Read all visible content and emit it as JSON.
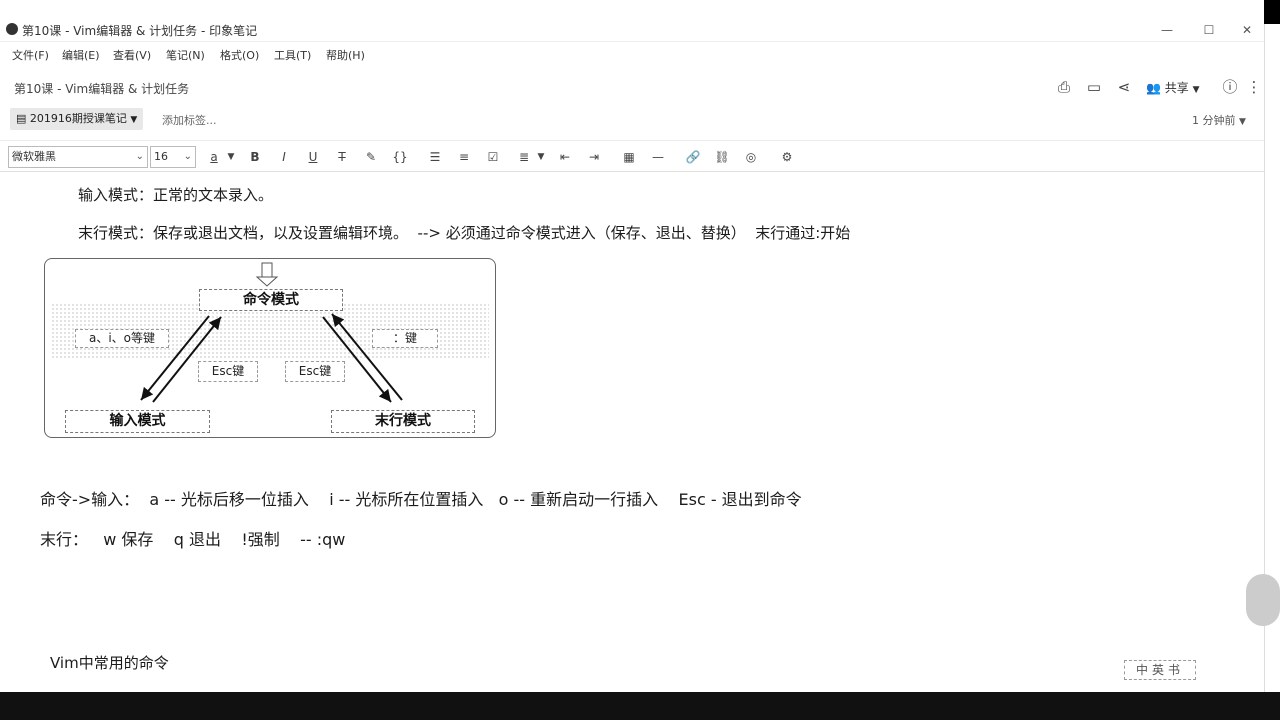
{
  "window": {
    "title": "第10课 - Vim编辑器 & 计划任务 - 印象笔记",
    "controls": [
      "—",
      "☐",
      "✕"
    ]
  },
  "menu": [
    "文件(F)",
    "编辑(E)",
    "查看(V)",
    "笔记(N)",
    "格式(O)",
    "工具(T)",
    "帮助(H)"
  ],
  "note": {
    "title": "第10课 - Vim编辑器 & 计划任务",
    "share_label": "共享",
    "notebook": "201916期授课笔记",
    "add_tag_placeholder": "添加标签...",
    "time_ago": "1 分钟前"
  },
  "toolbar": {
    "font": "微软雅黑",
    "size": "16"
  },
  "content": {
    "line1": "输入模式：正常的文本录入。",
    "line2": "末行模式：保存或退出文档，以及设置编辑环境。  --> 必须通过命令模式进入（保存、退出、替换）  末行通过:开始",
    "diagram": {
      "command": "命令模式",
      "insert": "输入模式",
      "lastline": "末行模式",
      "label_aio": "a、i、o等键",
      "label_colon": "：键",
      "esc_left": "Esc键",
      "esc_right": "Esc键"
    },
    "line3": "命令->输入：  a -- 光标后移一位插入    i -- 光标所在位置插入   o -- 重新启动一行插入    Esc - 退出到命令",
    "line4": "末行：   w 保存    q 退出    !强制    -- :qw",
    "line5": "Vim中常用的命令"
  },
  "stamp": "中英书"
}
